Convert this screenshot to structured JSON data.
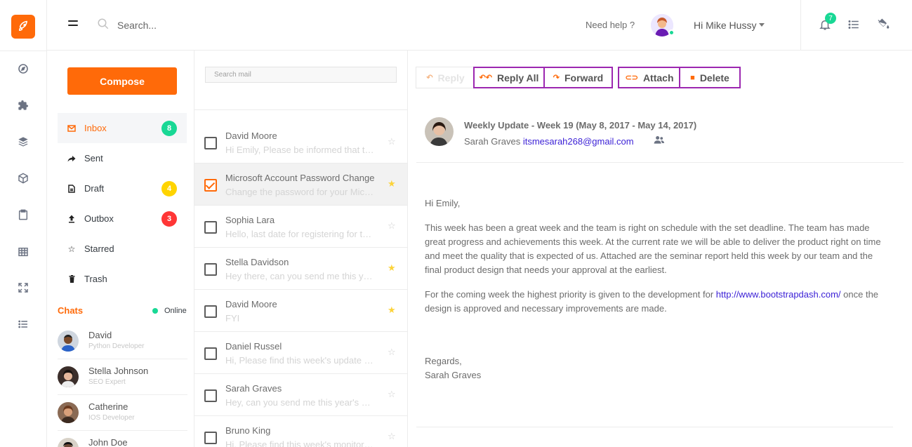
{
  "topbar": {
    "search_placeholder": "Search...",
    "help_text": "Need help ?",
    "user_greeting": "Hi Mike Hussy",
    "notification_count": "7"
  },
  "rail": {
    "icons": [
      "compass-icon",
      "puzzle-icon",
      "layers-icon",
      "box-icon",
      "clipboard-icon",
      "grid-icon",
      "expand-icon",
      "list-icon"
    ]
  },
  "nav": {
    "compose_label": "Compose",
    "items": [
      {
        "label": "Inbox",
        "icon": "mail-icon",
        "badge": "8",
        "badge_color": "#19d895"
      },
      {
        "label": "Sent",
        "icon": "share-icon",
        "badge": "",
        "badge_color": ""
      },
      {
        "label": "Draft",
        "icon": "file-icon",
        "badge": "4",
        "badge_color": "#ffd400"
      },
      {
        "label": "Outbox",
        "icon": "upload-icon",
        "badge": "3",
        "badge_color": "#ff3636"
      },
      {
        "label": "Starred",
        "icon": "star-icon",
        "badge": "",
        "badge_color": ""
      },
      {
        "label": "Trash",
        "icon": "trash-icon",
        "badge": "",
        "badge_color": ""
      }
    ],
    "chats_title": "Chats",
    "online_label": "Online",
    "chats": [
      {
        "name": "David",
        "role": "Python Developer"
      },
      {
        "name": "Stella Johnson",
        "role": "SEO Expert"
      },
      {
        "name": "Catherine",
        "role": "IOS Developer"
      },
      {
        "name": "John Doe",
        "role": ""
      }
    ]
  },
  "mail_list": {
    "search_placeholder": "Search mail",
    "rows": [
      {
        "sender": "David Moore",
        "preview": "Hi Emily, Please be informed that the new project presentation is due Monday.",
        "checked": false,
        "starred": false
      },
      {
        "sender": "Microsoft Account Password Change",
        "preview": "Change the password for your Microsoft Account using the security code.",
        "checked": true,
        "starred": true
      },
      {
        "sender": "Sophia Lara",
        "preview": "Hello, last date for registering for the annual event is today.",
        "checked": false,
        "starred": false
      },
      {
        "sender": "Stella Davidson",
        "preview": "Hey there, can you send me this year's peformance report?",
        "checked": false,
        "starred": true
      },
      {
        "sender": "David Moore",
        "preview": "FYI",
        "checked": false,
        "starred": true
      },
      {
        "sender": "Daniel Russel",
        "preview": "Hi, Please find this week's update report attached.",
        "checked": false,
        "starred": false
      },
      {
        "sender": "Sarah Graves",
        "preview": "Hey, can you send me this year's peformance report?",
        "checked": false,
        "starred": false
      },
      {
        "sender": "Bruno King",
        "preview": "Hi, Please find this week's monitoring report attached.",
        "checked": false,
        "starred": false
      }
    ]
  },
  "reader": {
    "toolbar": {
      "reply": "Reply",
      "reply_all": "Reply All",
      "forward": "Forward",
      "attach": "Attach",
      "delete": "Delete"
    },
    "subject": "Weekly Update - Week 19 (May 8, 2017 - May 14, 2017)",
    "from_name": "Sarah Graves",
    "from_email": "itsmesarah268@gmail.com",
    "greeting": "Hi Emily,",
    "paragraph1": "This week has been a great week and the team is right on schedule with the set deadline. The team has made great progress and achievements this week. At the current rate we will be able to deliver the product right on time and meet the quality that is expected of us. Attached are the seminar report held this week by our team and the final product design that needs your approval at the earliest.",
    "paragraph2_before": "For the coming week the highest priority is given to the development for ",
    "paragraph2_link": "http://www.bootstrapdash.com/",
    "paragraph2_after": " once the design is approved and necessary improvements are made.",
    "regards": "Regards,",
    "signature": "Sarah Graves"
  },
  "colors": {
    "accent": "#ff6a09",
    "link": "#3a1fd6",
    "button_border": "#9c27b0",
    "online": "#19d895"
  }
}
